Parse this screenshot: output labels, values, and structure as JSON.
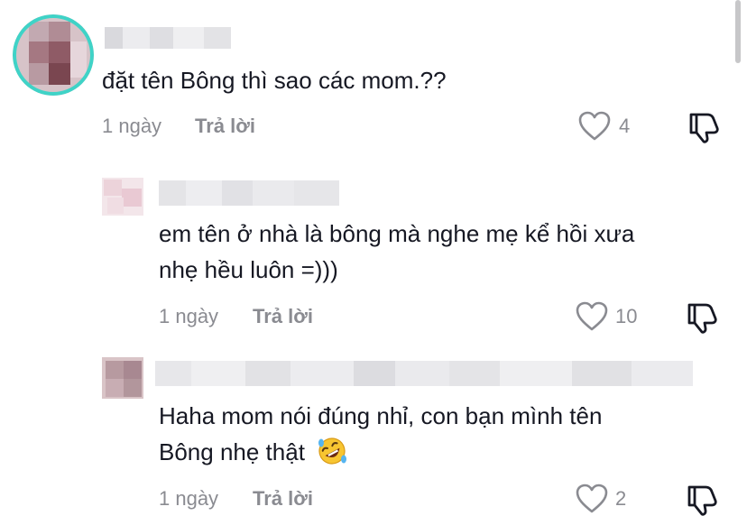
{
  "comments": [
    {
      "text": "đặt tên Bông thì sao các mom.??",
      "time": "1 ngày",
      "reply_label": "Trả lời",
      "likes": "4"
    }
  ],
  "replies": [
    {
      "text_line1": "em tên ở nhà là bông mà nghe mẹ kể hồi xưa",
      "text_line2": "nhẹ hều luôn =)))",
      "time": "1 ngày",
      "reply_label": "Trả lời",
      "likes": "10"
    },
    {
      "text_line1": "Haha mom nói đúng nhỉ, con bạn mình tên",
      "text_line2": "Bông nhẹ thật",
      "emoji": "rolling-on-floor-laughing",
      "time": "1 ngày",
      "reply_label": "Trả lời",
      "likes": "2"
    }
  ],
  "colors": {
    "text": "#161823",
    "meta": "#8a8b91",
    "avatar_ring": "#3fd3c7"
  }
}
